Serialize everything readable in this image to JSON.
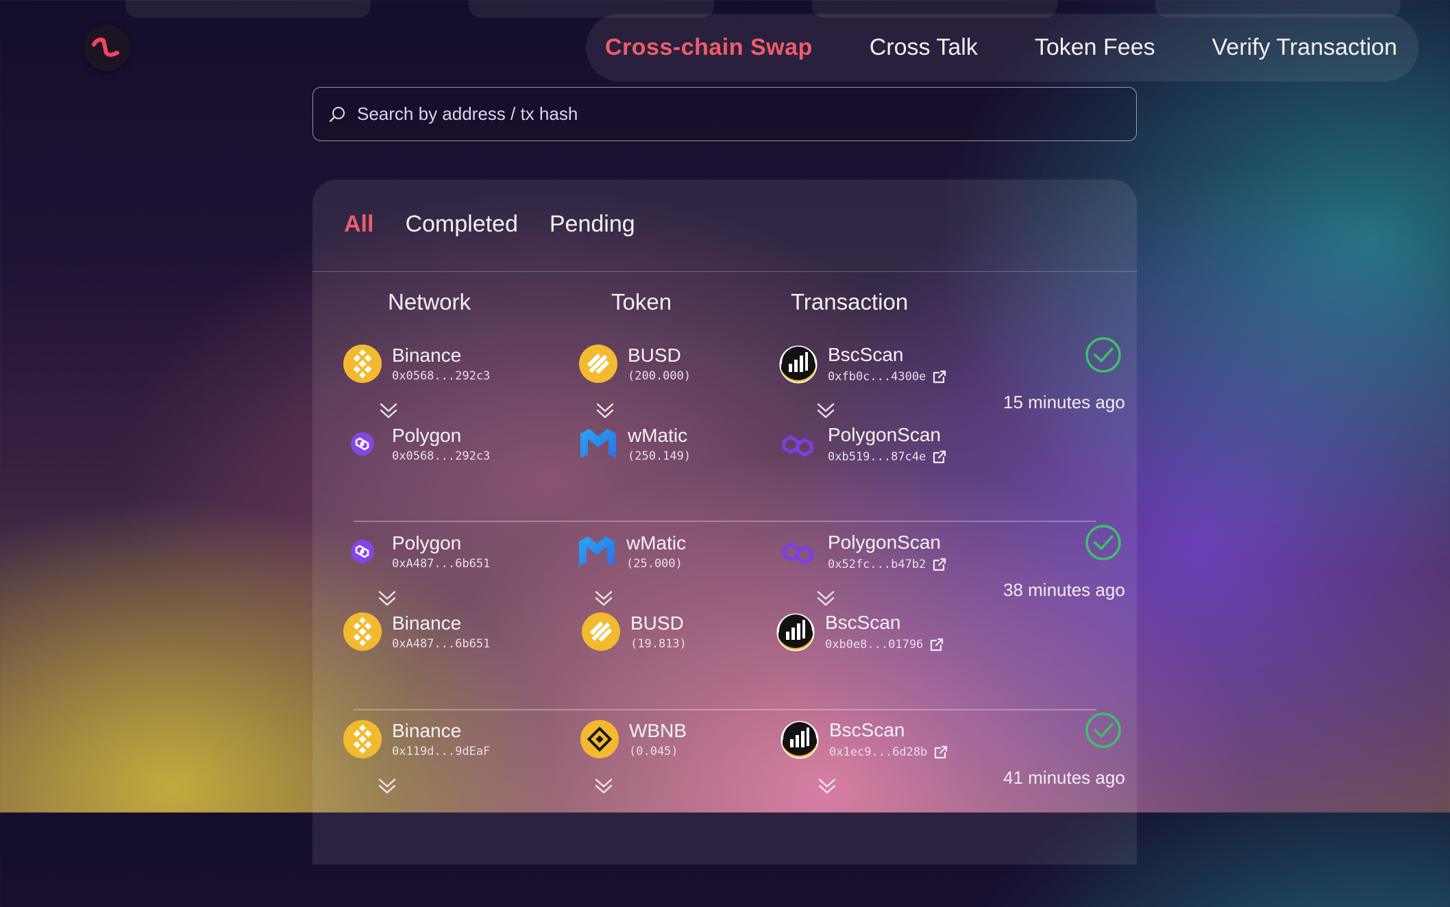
{
  "nav": {
    "items": [
      {
        "label": "Cross-chain Swap",
        "active": true
      },
      {
        "label": "Cross Talk",
        "active": false
      },
      {
        "label": "Token Fees",
        "active": false
      },
      {
        "label": "Verify Transaction",
        "active": false
      }
    ]
  },
  "search": {
    "placeholder": "Search by address / tx hash"
  },
  "tabs": [
    {
      "label": "All",
      "active": true
    },
    {
      "label": "Completed",
      "active": false
    },
    {
      "label": "Pending",
      "active": false
    }
  ],
  "columns": {
    "network": "Network",
    "token": "Token",
    "transaction": "Transaction"
  },
  "colors": {
    "accent": "#ee5d6a",
    "success": "#3fbf6a",
    "binance": "#f3ba2f",
    "polygon": "#8247e5"
  },
  "rows": [
    {
      "status": "check-circle-icon",
      "time": "15 minutes ago",
      "from": {
        "network": "Binance",
        "address": "0x0568...292c3",
        "token": "BUSD",
        "amount": "(200.000)",
        "explorer": "BscScan",
        "tx": "0xfb0c...4300e"
      },
      "to": {
        "network": "Polygon",
        "address": "0x0568...292c3",
        "token": "wMatic",
        "amount": "(250.149)",
        "explorer": "PolygonScan",
        "tx": "0xb519...87c4e"
      }
    },
    {
      "status": "check-circle-icon",
      "time": "38 minutes ago",
      "from": {
        "network": "Polygon",
        "address": "0xA487...6b651",
        "token": "wMatic",
        "amount": "(25.000)",
        "explorer": "PolygonScan",
        "tx": "0x52fc...b47b2"
      },
      "to": {
        "network": "Binance",
        "address": "0xA487...6b651",
        "token": "BUSD",
        "amount": "(19.813)",
        "explorer": "BscScan",
        "tx": "0xb0e8...01796"
      }
    },
    {
      "status": "check-circle-icon",
      "time": "41 minutes ago",
      "from": {
        "network": "Binance",
        "address": "0x119d...9dEaF",
        "token": "WBNB",
        "amount": "(0.045)",
        "explorer": "BscScan",
        "tx": "0x1ec9...6d28b"
      }
    }
  ]
}
